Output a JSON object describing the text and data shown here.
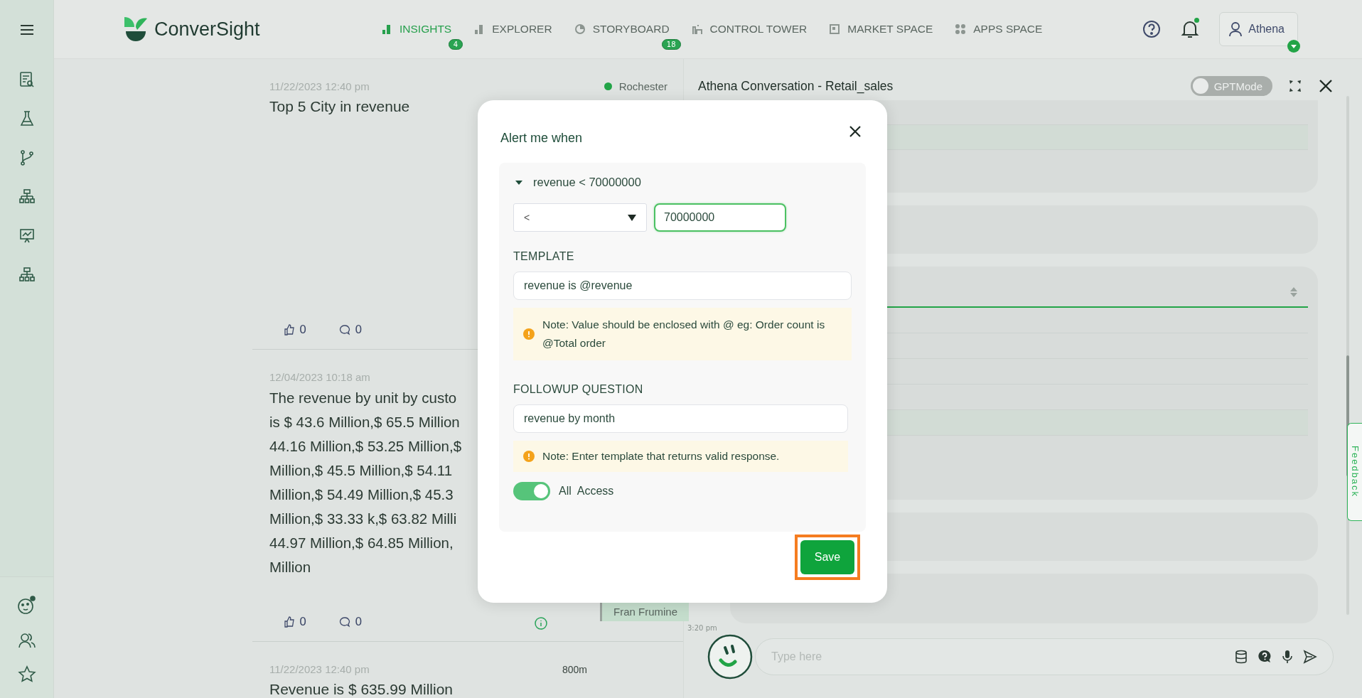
{
  "header": {
    "logo": "ConverSight",
    "tabs": [
      {
        "label": "INSIGHTS",
        "selected": true,
        "badge": "4"
      },
      {
        "label": "EXPLORER",
        "selected": false
      },
      {
        "label": "STORYBOARD",
        "selected": false,
        "badge": "18"
      },
      {
        "label": "CONTROL TOWER",
        "selected": false
      },
      {
        "label": "MARKET SPACE",
        "selected": false
      },
      {
        "label": "APPS SPACE",
        "selected": false
      }
    ],
    "notifications_unread": true,
    "user": "Athena"
  },
  "feed": {
    "cards": [
      {
        "date": "11/22/2023 12:40 pm",
        "title": "Top 5 City in revenue",
        "legend": "Rochester",
        "likes": "0",
        "comments": "0"
      },
      {
        "date": "12/04/2023 10:18 am",
        "lines": [
          "The revenue by unit by custo",
          "is $ 43.6 Million,$ 65.5 Million",
          "44.16 Million,$ 53.25 Million,$",
          "Million,$ 45.5 Million,$ 54.11",
          "Million,$ 54.49 Million,$ 45.3",
          "Million,$ 33.33 k,$ 63.82 Milli",
          "44.97 Million,$ 64.85 Million,",
          "Million"
        ],
        "tag": "Fran Frumine",
        "likes": "0",
        "comments": "0"
      },
      {
        "date": "11/22/2023 12:40 pm",
        "axis_label": "800m",
        "title": "Revenue is $ 635.99 Million"
      }
    ]
  },
  "conversation": {
    "title": "Athena Conversation - Retail_sales",
    "gpt_mode": {
      "label": "GPTMode",
      "on": false
    },
    "time": "3:20 pm",
    "placeholder": "Type here",
    "feedback": "Feedback"
  },
  "dialog": {
    "title": "Alert me when",
    "condition": {
      "label": "revenue < 70000000",
      "expanded": true,
      "operator": "<",
      "value": "70000000"
    },
    "template": {
      "label": "TEMPLATE",
      "value": "revenue is @revenue",
      "note": "Note: Value should be enclosed with @ eg: Order count is @Total order"
    },
    "followup": {
      "label": "FOLLOWUP QUESTION",
      "value": "revenue by month",
      "note": "Note: Enter template that returns valid response."
    },
    "access": {
      "label": "All  Access",
      "on": true
    },
    "save": "Save"
  }
}
